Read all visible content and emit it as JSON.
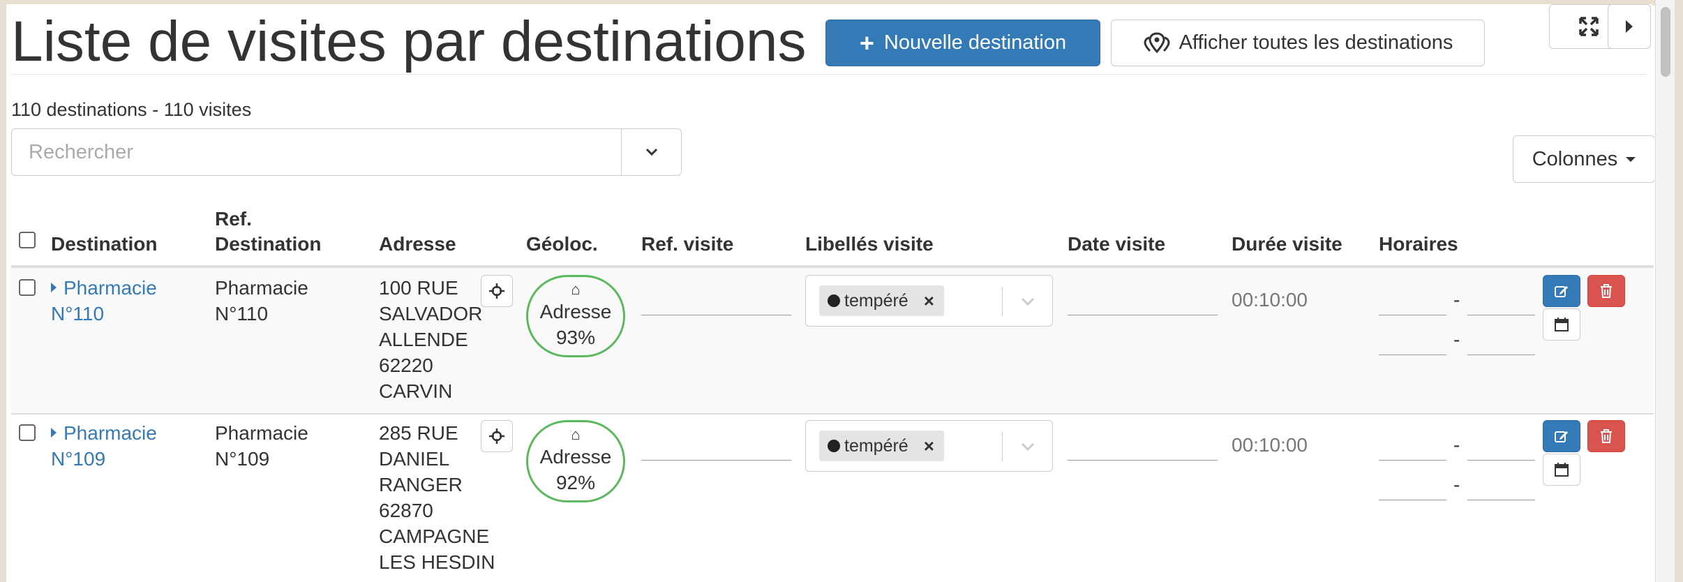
{
  "header": {
    "title": "Liste de visites par destinations",
    "new_button_label": "Nouvelle destination",
    "show_all_label": "Afficher toutes les destinations"
  },
  "summary": {
    "counts": "110 destinations - 110 visites"
  },
  "search": {
    "placeholder": "Rechercher",
    "value": ""
  },
  "columns_button_label": "Colonnes",
  "table": {
    "headers": {
      "destination": "Destination",
      "ref_destination_1": "Ref.",
      "ref_destination_2": "Destination",
      "adresse": "Adresse",
      "geoloc": "Géoloc.",
      "ref_visite": "Ref. visite",
      "libelles": "Libellés visite",
      "date": "Date visite",
      "duree": "Durée visite",
      "horaires": "Horaires"
    },
    "rows": [
      {
        "destination_1": "Pharmacie",
        "destination_2": "N°110",
        "ref_1": "Pharmacie",
        "ref_2": "N°110",
        "address": [
          "100 RUE",
          "SALVADOR",
          "ALLENDE",
          "62220",
          "CARVIN"
        ],
        "geo_label": "Adresse",
        "geo_score": "93%",
        "tag": "tempéré",
        "duration": "00:10:00",
        "dash": "-"
      },
      {
        "destination_1": "Pharmacie",
        "destination_2": "N°109",
        "ref_1": "Pharmacie",
        "ref_2": "N°109",
        "address": [
          "285 RUE",
          "DANIEL",
          "RANGER",
          "62870",
          "CAMPAGNE",
          "LES HESDIN"
        ],
        "geo_label": "Adresse",
        "geo_score": "92%",
        "tag": "tempéré",
        "duration": "00:10:00",
        "dash": "-"
      }
    ]
  },
  "colors": {
    "primary": "#337ab7",
    "danger": "#d9534f",
    "geo_ok": "#5cb85c"
  }
}
